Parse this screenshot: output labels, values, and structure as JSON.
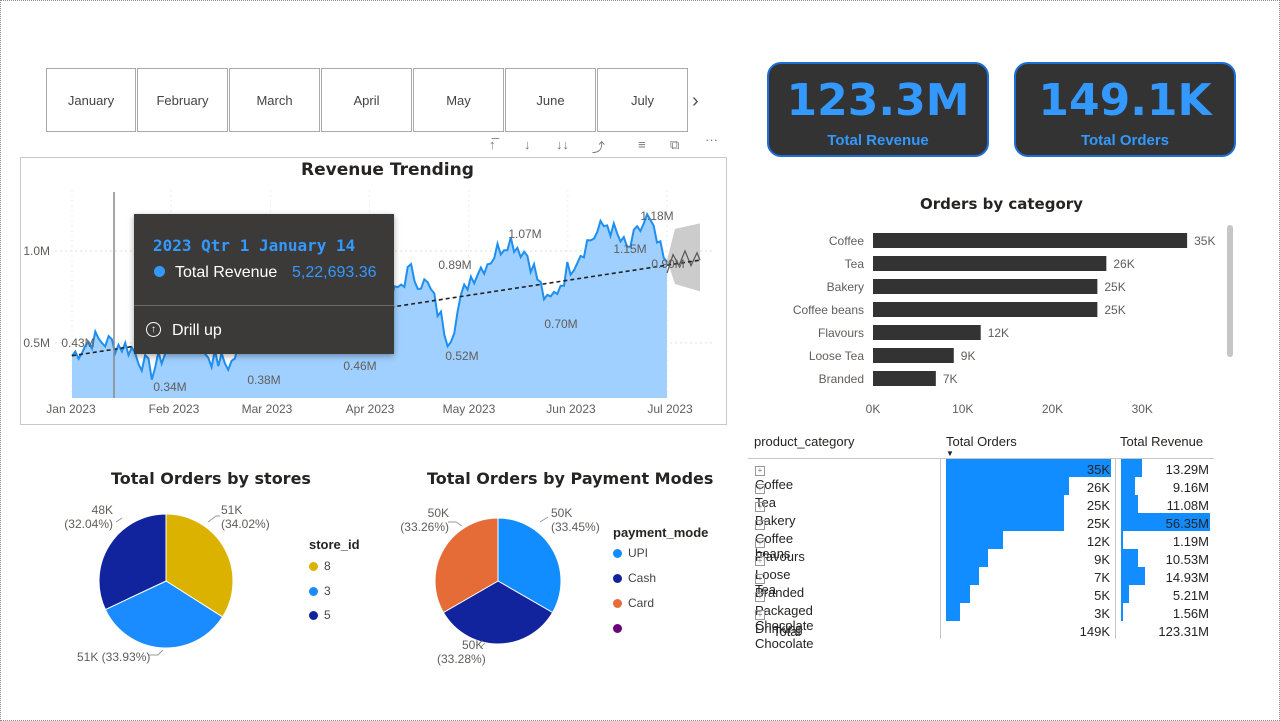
{
  "slicer": {
    "months": [
      "January",
      "February",
      "March",
      "April",
      "May",
      "June",
      "July"
    ],
    "next_icon": "chevron-right-icon"
  },
  "toolbar_icons": [
    "drill-up-icon",
    "drill-down-icon",
    "expand-all-icon",
    "drill-mode-icon",
    "filter-icon",
    "focus-mode-icon",
    "more-options-icon"
  ],
  "kpis": [
    {
      "value": "123.3M",
      "label": "Total Revenue"
    },
    {
      "value": "149.1K",
      "label": "Total Orders"
    }
  ],
  "tooltip": {
    "header": "2023 Qtr 1 January 14",
    "series": "Total Revenue",
    "value": "5,22,693.36",
    "action": "Drill up"
  },
  "chart_data": [
    {
      "type": "area",
      "title": "Revenue Trending",
      "x_ticks": [
        "Jan 2023",
        "Feb 2023",
        "Mar 2023",
        "Apr 2023",
        "May 2023",
        "Jun 2023",
        "Jul 2023"
      ],
      "y_ticks": [
        "0.5M",
        "1.0M"
      ],
      "ylim": [
        0.2,
        1.25
      ],
      "series": [
        {
          "values": [
            0.43,
            0.52,
            0.5,
            0.47,
            0.34,
            0.5,
            0.55,
            0.42,
            0.38,
            0.6,
            0.55,
            0.46,
            0.58,
            0.62,
            0.66,
            0.7,
            0.72,
            0.89,
            0.8,
            0.52,
            0.85,
            0.95,
            1.07,
            0.98,
            0.7,
            0.9,
            1.05,
            1.15,
            1.0,
            1.18,
            0.9
          ]
        }
      ],
      "data_labels": [
        "0.43M",
        "0.34M",
        "0.38M",
        "0.46M",
        "0.89M",
        "0.52M",
        "1.07M",
        "0.70M",
        "1.15M",
        "1.18M",
        "0.90M"
      ],
      "trend_line": true,
      "forecast": true,
      "colors": {
        "area": "#9fd0ff",
        "line": "#1e8ff0",
        "trend": "#222222",
        "forecast": "#cccccc"
      }
    },
    {
      "type": "bar",
      "title": "Orders by category",
      "categories": [
        "Coffee",
        "Tea",
        "Bakery",
        "Coffee beans",
        "Flavours",
        "Loose Tea",
        "Branded"
      ],
      "values": [
        35,
        26,
        25,
        25,
        12,
        9,
        7
      ],
      "value_labels": [
        "35K",
        "26K",
        "25K",
        "25K",
        "12K",
        "9K",
        "7K"
      ],
      "x_ticks": [
        "0K",
        "10K",
        "20K",
        "30K"
      ],
      "xlim": [
        0,
        40
      ],
      "color": "#333333"
    },
    {
      "type": "pie",
      "title": "Total Orders by stores",
      "legend_title": "store_id",
      "slices": [
        {
          "name": "8",
          "value": 51,
          "label": "51K",
          "pct": "(34.02%)",
          "color": "#dbb200"
        },
        {
          "name": "3",
          "value": 51,
          "label": "51K (33.93%)",
          "pct": "",
          "color": "#1a8cff"
        },
        {
          "name": "5",
          "value": 48,
          "label": "48K",
          "pct": "(32.04%)",
          "color": "#12239e"
        }
      ]
    },
    {
      "type": "pie",
      "title": "Total Orders by Payment Modes",
      "legend_title": "payment_mode",
      "slices": [
        {
          "name": "UPI",
          "value": 50,
          "label": "50K",
          "pct": "(33.45%)",
          "color": "#118dff"
        },
        {
          "name": "Cash",
          "value": 50,
          "label": "50K",
          "pct": "(33.28%)",
          "color": "#12239e"
        },
        {
          "name": "Card",
          "value": 50,
          "label": "50K",
          "pct": "(33.26%)",
          "color": "#e66c37"
        },
        {
          "name": "",
          "value": 0,
          "label": "",
          "pct": "",
          "color": "#6b007b"
        }
      ]
    }
  ],
  "table": {
    "headers": [
      "product_category",
      "Total Orders",
      "Total Revenue"
    ],
    "rows": [
      {
        "name": "Coffee",
        "orders": "35K",
        "orders_v": 35,
        "revenue": "13.29M",
        "revenue_v": 13.29
      },
      {
        "name": "Tea",
        "orders": "26K",
        "orders_v": 26,
        "revenue": "9.16M",
        "revenue_v": 9.16
      },
      {
        "name": "Bakery",
        "orders": "25K",
        "orders_v": 25,
        "revenue": "11.08M",
        "revenue_v": 11.08
      },
      {
        "name": "Coffee beans",
        "orders": "25K",
        "orders_v": 25,
        "revenue": "56.35M",
        "revenue_v": 56.35
      },
      {
        "name": "Flavours",
        "orders": "12K",
        "orders_v": 12,
        "revenue": "1.19M",
        "revenue_v": 1.19
      },
      {
        "name": "Loose Tea",
        "orders": "9K",
        "orders_v": 9,
        "revenue": "10.53M",
        "revenue_v": 10.53
      },
      {
        "name": "Branded",
        "orders": "7K",
        "orders_v": 7,
        "revenue": "14.93M",
        "revenue_v": 14.93
      },
      {
        "name": "Packaged Chocolate",
        "orders": "5K",
        "orders_v": 5,
        "revenue": "5.21M",
        "revenue_v": 5.21
      },
      {
        "name": "Drinking Chocolate",
        "orders": "3K",
        "orders_v": 3,
        "revenue": "1.56M",
        "revenue_v": 1.56
      }
    ],
    "total": {
      "label": "Total",
      "orders": "149K",
      "revenue": "123.31M"
    },
    "bar_color": "#118dff"
  }
}
